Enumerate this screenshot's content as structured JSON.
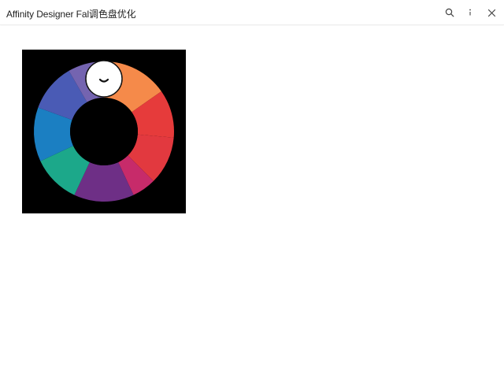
{
  "window": {
    "title": "Affinity Designer Fal调色盘优化"
  },
  "toolbar": {
    "icons": [
      "search-icon",
      "info-icon",
      "close-icon"
    ]
  },
  "color_wheel": {
    "background": "#000000",
    "selector_fill": "#ffffff",
    "selector_stroke": "#111111",
    "center_fill": "#000000",
    "segments": [
      {
        "color": "#f58a4a"
      },
      {
        "color": "#e63b3b"
      },
      {
        "color": "#e2393f"
      },
      {
        "color": "#c72b6a"
      },
      {
        "color": "#6e2f86"
      },
      {
        "color": "#1ca88a"
      },
      {
        "color": "#1b7fc2"
      },
      {
        "color": "#4a5bb5"
      },
      {
        "color": "#7464b0"
      }
    ]
  }
}
